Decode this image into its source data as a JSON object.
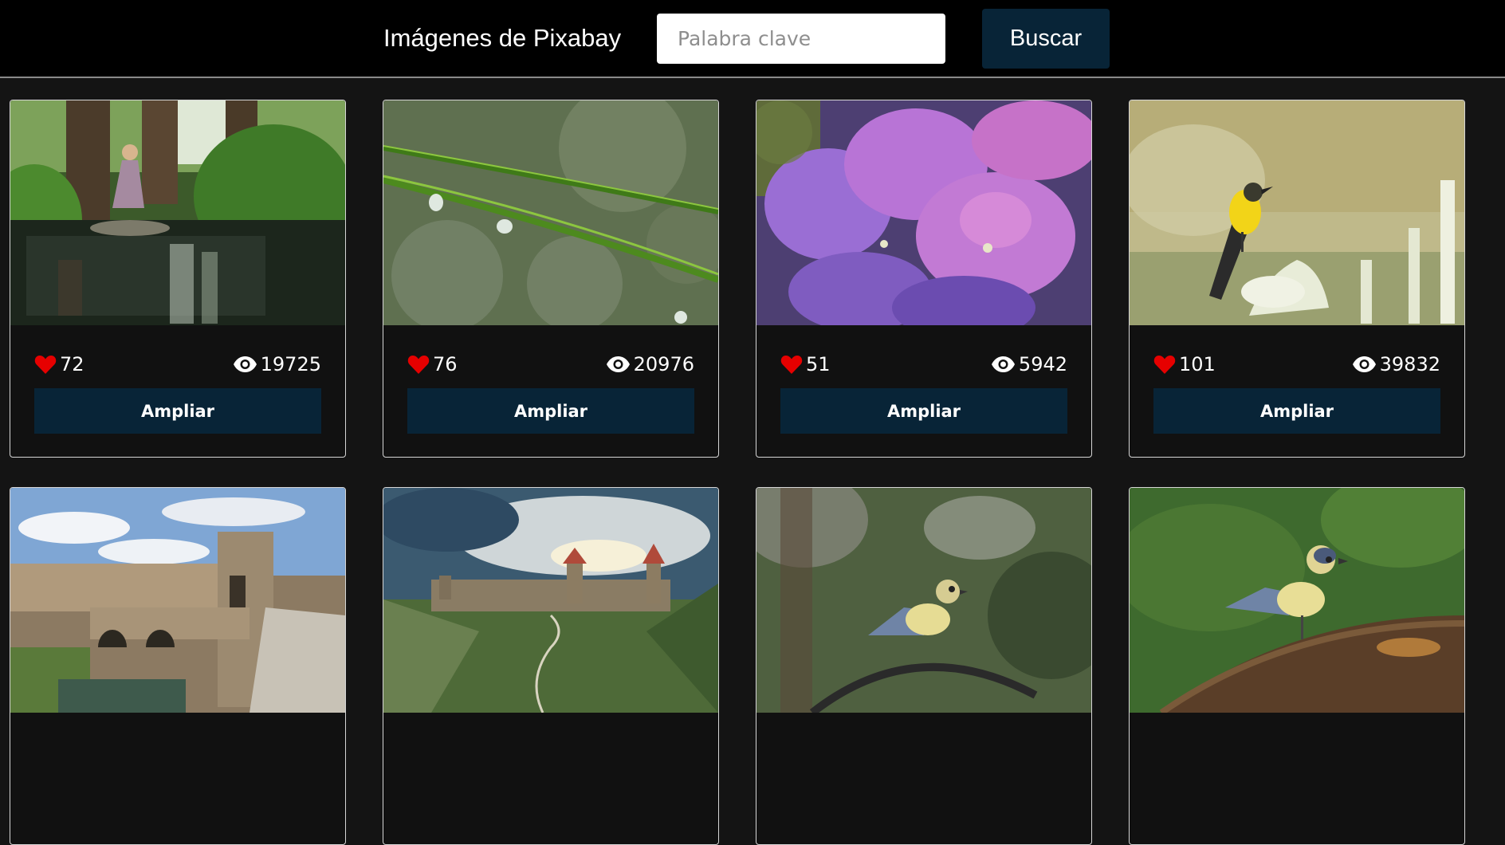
{
  "header": {
    "title": "Imágenes de Pixabay",
    "search_placeholder": "Palabra clave",
    "search_value": "",
    "search_button": "Buscar"
  },
  "colors": {
    "page_bg": "#141414",
    "header_bg": "#000000",
    "button_bg": "#082437",
    "heart": "#e60000"
  },
  "cards": [
    {
      "likes": "72",
      "views": "19725",
      "button": "Ampliar",
      "photo": "girl-stepping-on-stone-in-forest-stream"
    },
    {
      "likes": "76",
      "views": "20976",
      "button": "Ampliar",
      "photo": "water-drops-on-grass-blades"
    },
    {
      "likes": "51",
      "views": "5942",
      "button": "Ampliar",
      "photo": "purple-hydrangea-flowers"
    },
    {
      "likes": "101",
      "views": "39832",
      "button": "Ampliar",
      "photo": "yellow-wagtail-on-white-flowers"
    },
    {
      "photo": "medieval-stone-bridge-and-village"
    },
    {
      "photo": "walled-castle-in-green-valley"
    },
    {
      "photo": "blue-tit-on-curved-branch"
    },
    {
      "photo": "blue-tit-on-wooden-barrel"
    }
  ]
}
